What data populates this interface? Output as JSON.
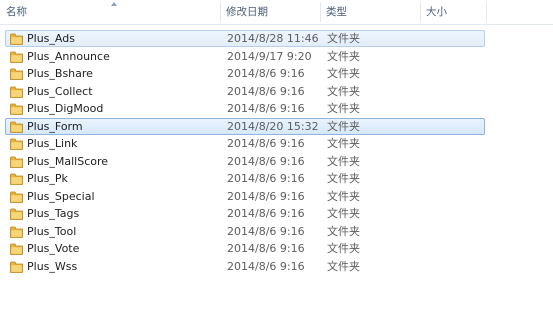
{
  "columns": {
    "name": "名称",
    "modified": "修改日期",
    "type": "类型",
    "size": "大小"
  },
  "files": [
    {
      "name": "Plus_Ads",
      "date": "2014/8/28 11:46",
      "type": "文件夹",
      "selected": true
    },
    {
      "name": "Plus_Announce",
      "date": "2014/9/17 9:20",
      "type": "文件夹"
    },
    {
      "name": "Plus_Bshare",
      "date": "2014/8/6 9:16",
      "type": "文件夹"
    },
    {
      "name": "Plus_Collect",
      "date": "2014/8/6 9:16",
      "type": "文件夹"
    },
    {
      "name": "Plus_DigMood",
      "date": "2014/8/6 9:16",
      "type": "文件夹"
    },
    {
      "name": "Plus_Form",
      "date": "2014/8/20 15:32",
      "type": "文件夹",
      "selected": true
    },
    {
      "name": "Plus_Link",
      "date": "2014/8/6 9:16",
      "type": "文件夹"
    },
    {
      "name": "Plus_MallScore",
      "date": "2014/8/6 9:16",
      "type": "文件夹"
    },
    {
      "name": "Plus_Pk",
      "date": "2014/8/6 9:16",
      "type": "文件夹"
    },
    {
      "name": "Plus_Special",
      "date": "2014/8/6 9:16",
      "type": "文件夹"
    },
    {
      "name": "Plus_Tags",
      "date": "2014/8/6 9:16",
      "type": "文件夹"
    },
    {
      "name": "Plus_Tool",
      "date": "2014/8/6 9:16",
      "type": "文件夹"
    },
    {
      "name": "Plus_Vote",
      "date": "2014/8/6 9:16",
      "type": "文件夹"
    },
    {
      "name": "Plus_Wss",
      "date": "2014/8/6 9:16",
      "type": "文件夹"
    }
  ],
  "colors": {
    "selection_fill": "#d6e8fb",
    "selection_border": "#8fb4df",
    "folder": "#e8b33a",
    "header_text": "#4c607a"
  }
}
